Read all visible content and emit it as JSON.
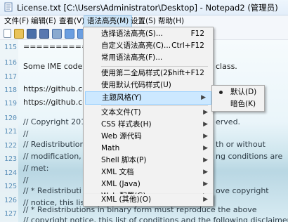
{
  "window": {
    "title": "License.txt [C:\\Users\\Administrator\\Desktop] - Notepad2 (管理员)"
  },
  "menubar": [
    "文件(F)",
    "编辑(E)",
    "查看(V)",
    "语法高亮(M)",
    "设置(S)",
    "帮助(H)"
  ],
  "editor": {
    "line_numbers": [
      "115",
      "116",
      "117",
      "118",
      "119",
      "120",
      "121",
      "122",
      "123",
      "124",
      "125",
      "126",
      "127",
      "128",
      "129"
    ],
    "lines": [
      "==========",
      "Some IME code b",
      "",
      "https://github.com",
      "https://github.com",
      "// Copyright 2015",
      "//",
      "// Redistribution a",
      "// modification, a",
      "// met:",
      "//",
      "//    * Redistributi",
      "// notice, this list",
      "//    * Redistributions in binary form must reproduce the above",
      "// copyright notice, this list of conditions and the following disclaimer"
    ],
    "right_fragments": {
      "116": "class.",
      "120": "erved.",
      "122": "th or without",
      "123": "ng conditions are",
      "126": "ove copyright"
    }
  },
  "syntax_menu": {
    "items": [
      {
        "label": "选择语法高亮(S)...",
        "shortcut": "F12"
      },
      {
        "label": "自定义语法高亮(C)...",
        "shortcut": "Ctrl+F12"
      },
      {
        "label": "常用语法高亮(F)...",
        "shortcut": ""
      },
      {
        "label": "使用第二全局样式(2)",
        "shortcut": "Shift+F12"
      },
      {
        "label": "使用默认代码样式(U)",
        "shortcut": ""
      },
      {
        "label": "主题风格(Y)",
        "shortcut": ""
      },
      {
        "label": "文本文件(T)",
        "shortcut": ""
      },
      {
        "label": "CSS 样式表(H)",
        "shortcut": ""
      },
      {
        "label": "Web 源代码",
        "shortcut": ""
      },
      {
        "label": "Math",
        "shortcut": ""
      },
      {
        "label": "Shell 脚本(P)",
        "shortcut": ""
      },
      {
        "label": "XML 文档",
        "shortcut": ""
      },
      {
        "label": "XML (Java)",
        "shortcut": ""
      },
      {
        "label": "Web 配置(G)",
        "shortcut": ""
      },
      {
        "label": "XML (其他)(O)",
        "shortcut": ""
      }
    ]
  },
  "theme_submenu": {
    "items": [
      {
        "label": "默认(D)",
        "checked": true
      },
      {
        "label": "暗色(K)",
        "checked": false
      }
    ]
  },
  "colors": {
    "menu_highlight": "#cce8ff",
    "line_number": "#5a8fb8"
  }
}
